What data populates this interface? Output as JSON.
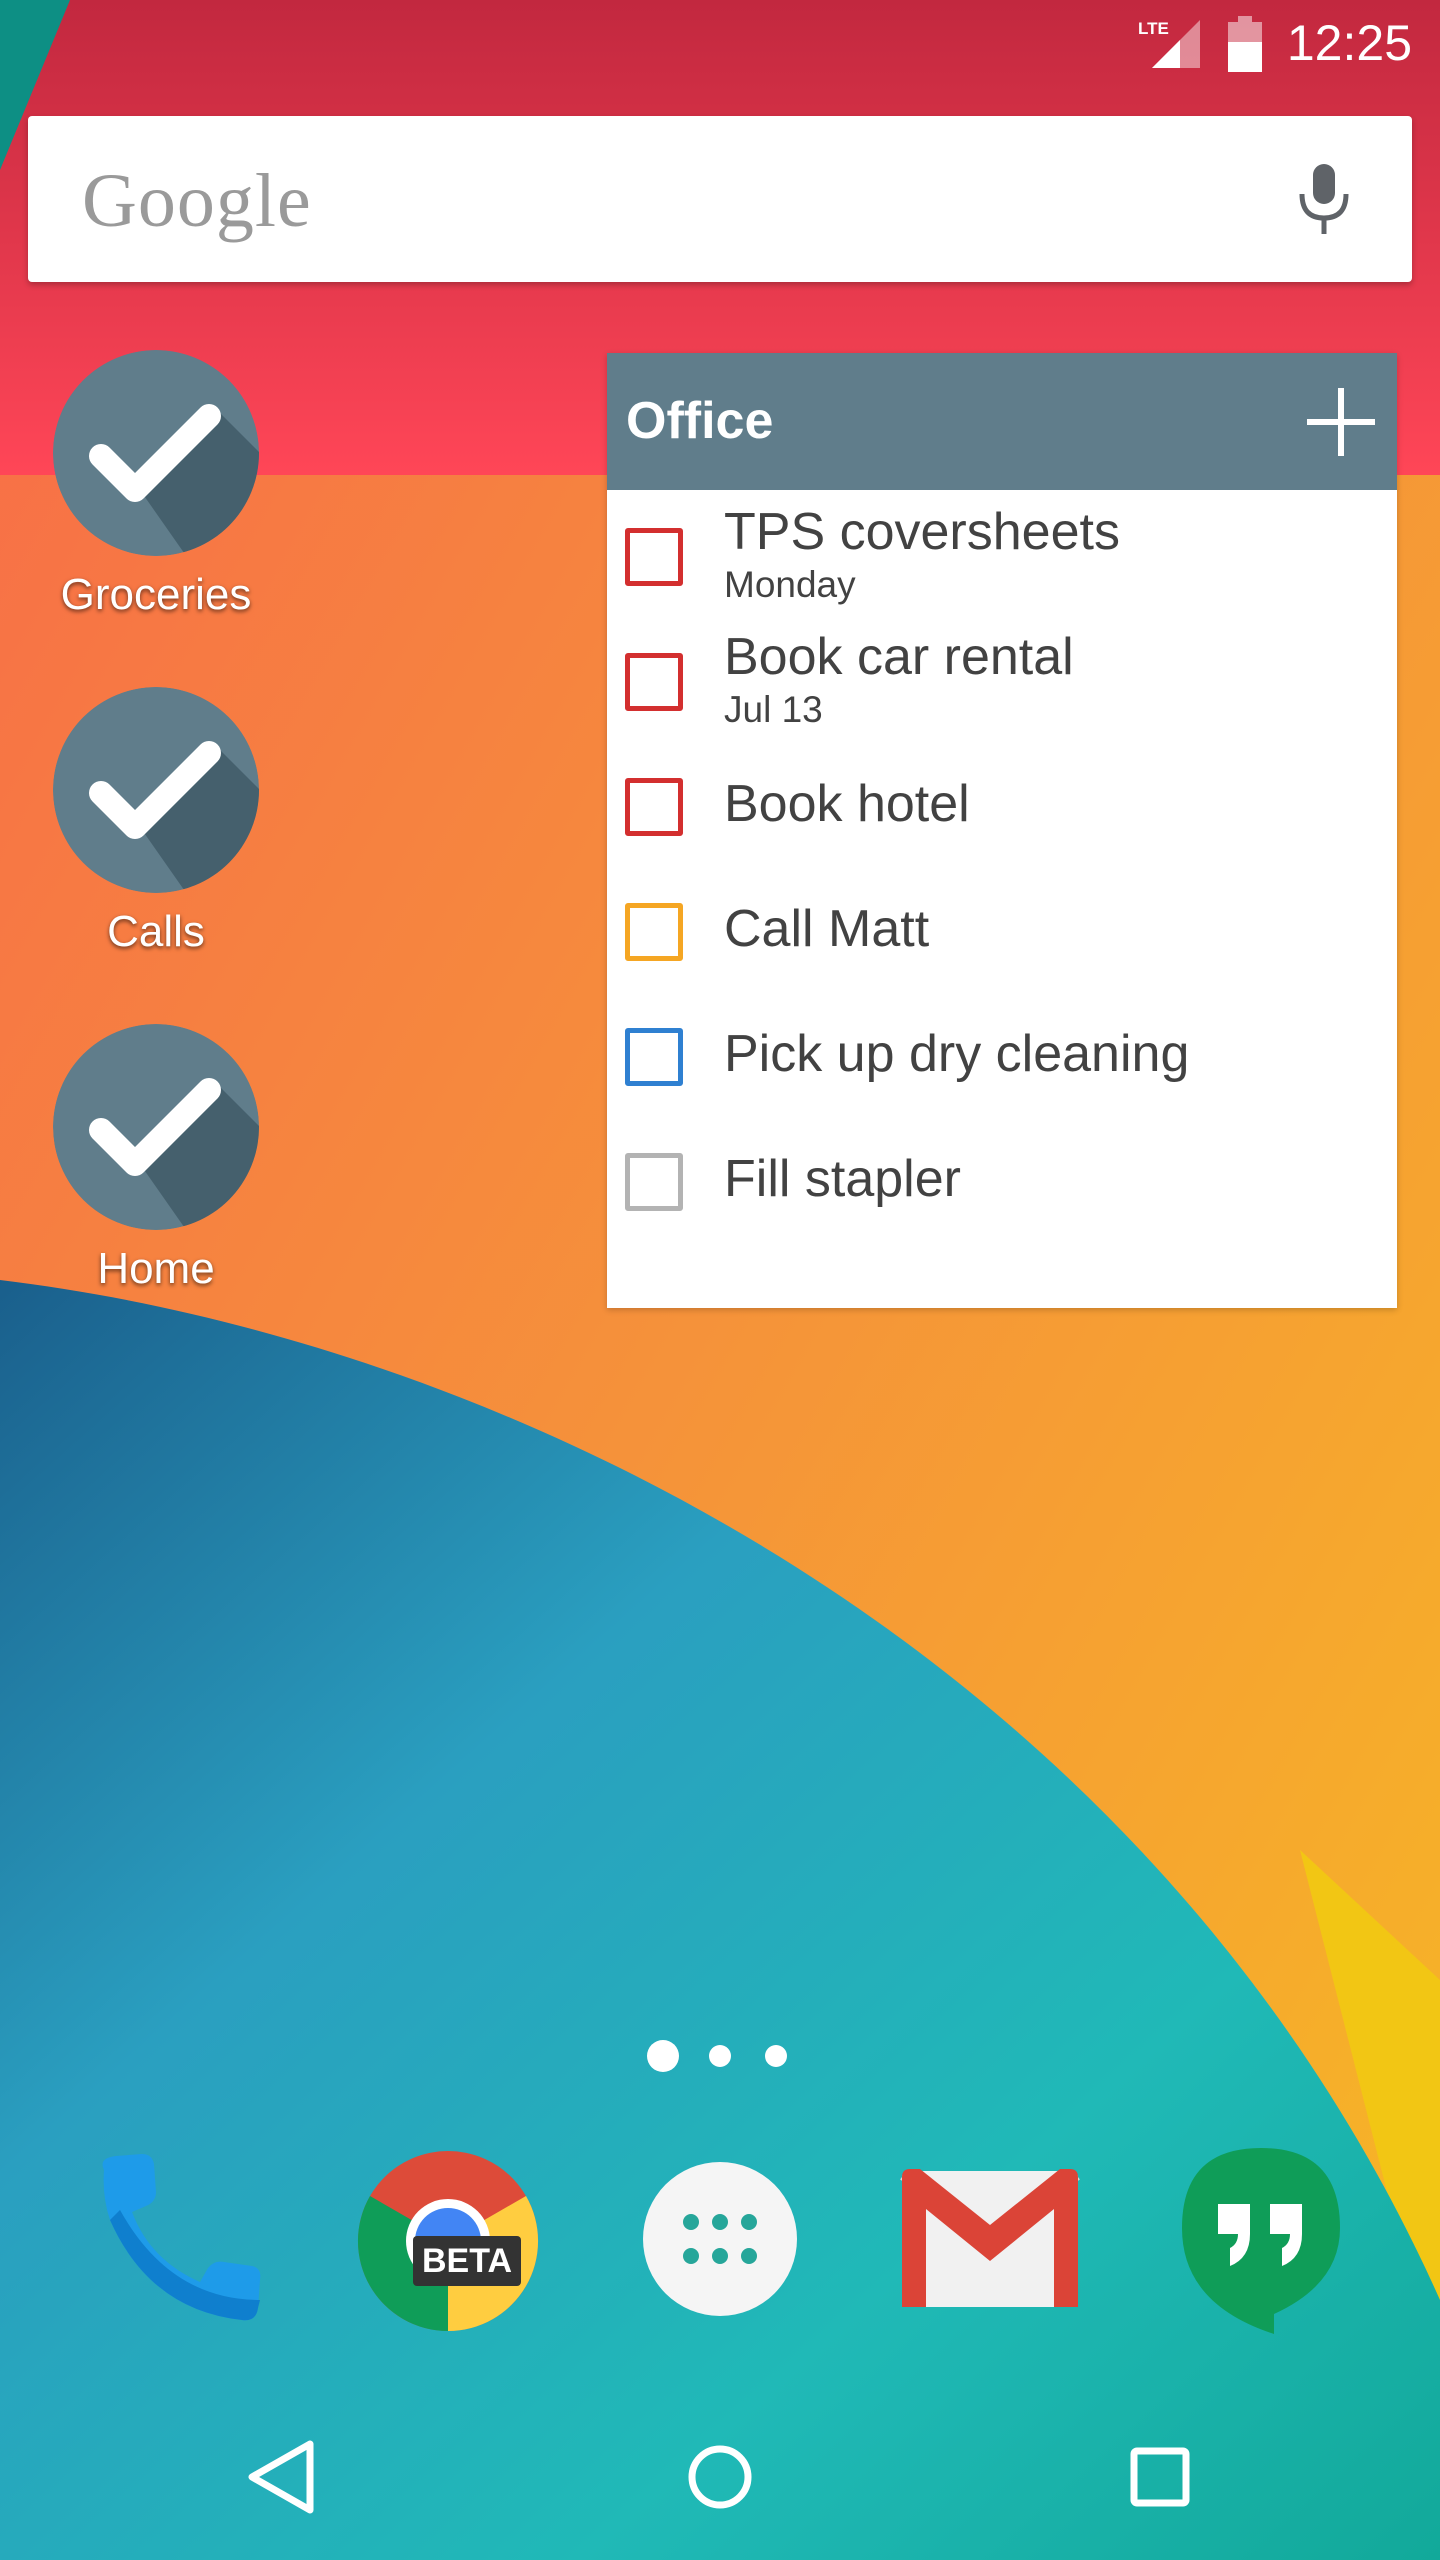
{
  "status_bar": {
    "network_label": "LTE",
    "time": "12:25"
  },
  "search": {
    "logo_text": "Google"
  },
  "shortcuts": [
    {
      "label": "Groceries"
    },
    {
      "label": "Calls"
    },
    {
      "label": "Home"
    }
  ],
  "widget": {
    "title": "Office",
    "tasks": [
      {
        "title": "TPS coversheets",
        "due": "Monday",
        "priority_color": "#d32f2f"
      },
      {
        "title": "Book car rental",
        "due": "Jul 13",
        "priority_color": "#d32f2f"
      },
      {
        "title": "Book hotel",
        "priority_color": "#d32f2f"
      },
      {
        "title": "Call Matt",
        "priority_color": "#f5a623"
      },
      {
        "title": "Pick up dry cleaning",
        "priority_color": "#2f80d1"
      },
      {
        "title": "Fill stapler",
        "priority_color": "#b3b3b3"
      }
    ]
  },
  "pages": {
    "count": 3,
    "active": 0
  },
  "dock": [
    {
      "icon": "phone-icon"
    },
    {
      "icon": "chrome-beta-icon",
      "badge": "BETA"
    },
    {
      "icon": "app-drawer-icon"
    },
    {
      "icon": "gmail-icon"
    },
    {
      "icon": "hangouts-icon"
    }
  ],
  "nav": [
    {
      "icon": "back-icon"
    },
    {
      "icon": "home-icon"
    },
    {
      "icon": "recents-icon"
    }
  ],
  "colors": {
    "widget_header": "#607d8b",
    "shortcut_circle": "#607d8b",
    "wallpaper_top": "#e8343f",
    "wallpaper_orange": "#f5923a",
    "wallpaper_teal": "#1ab5b3"
  }
}
